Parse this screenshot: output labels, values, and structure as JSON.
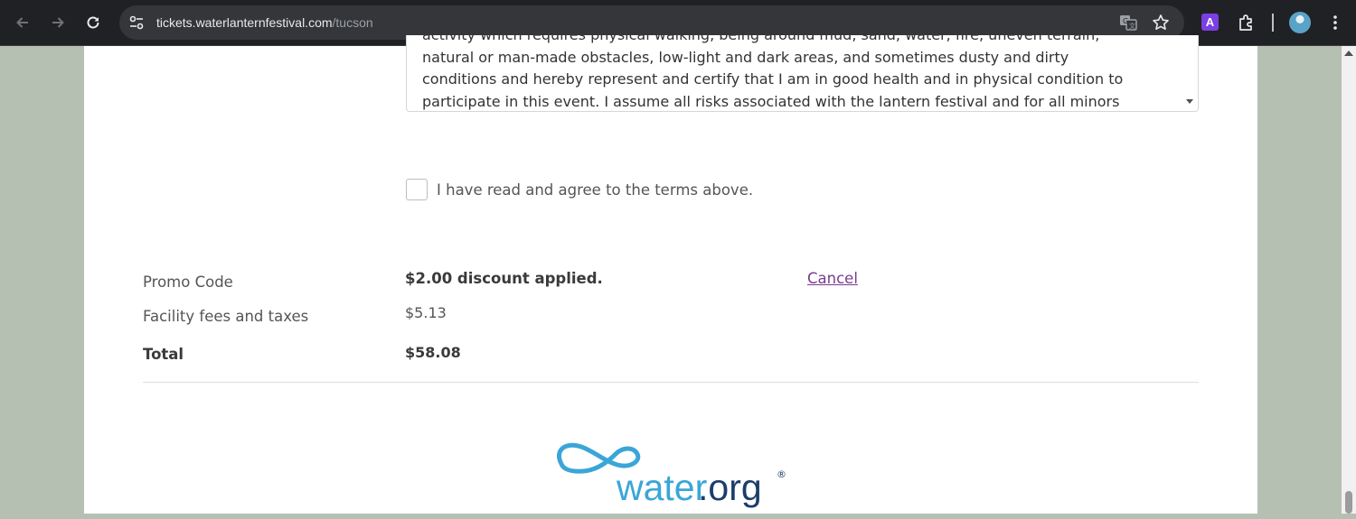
{
  "browser": {
    "url_host": "tickets.waterlanternfestival.com",
    "url_path": "/tucson",
    "extension_badge": "A"
  },
  "terms": {
    "lines": [
      "activity which requires physical walking, being around mud, sand, water, fire, uneven terrain,",
      "natural or man-made obstacles, low-light and dark areas, and sometimes dusty and dirty",
      "conditions and hereby represent and certify that I am in good health and in physical condition to",
      "participate in this event. I assume all risks associated with the lantern festival and for all minors"
    ],
    "agree_label": "I have read and agree to the terms above.",
    "agree_checked": false
  },
  "summary": {
    "promo_label": "Promo Code",
    "promo_value": "$2.00 discount applied.",
    "cancel_label": "Cancel",
    "fees_label": "Facility fees and taxes",
    "fees_value": "$5.13",
    "total_label": "Total",
    "total_value": "$58.08"
  },
  "footer": {
    "logo_text_a": "water",
    "logo_text_b": ".org",
    "logo_mark": "®"
  },
  "colors": {
    "link": "#7a3b8f",
    "logo_blue": "#3aa6d8",
    "logo_navy": "#1c3d6b",
    "page_bg": "#b5c0b3"
  }
}
